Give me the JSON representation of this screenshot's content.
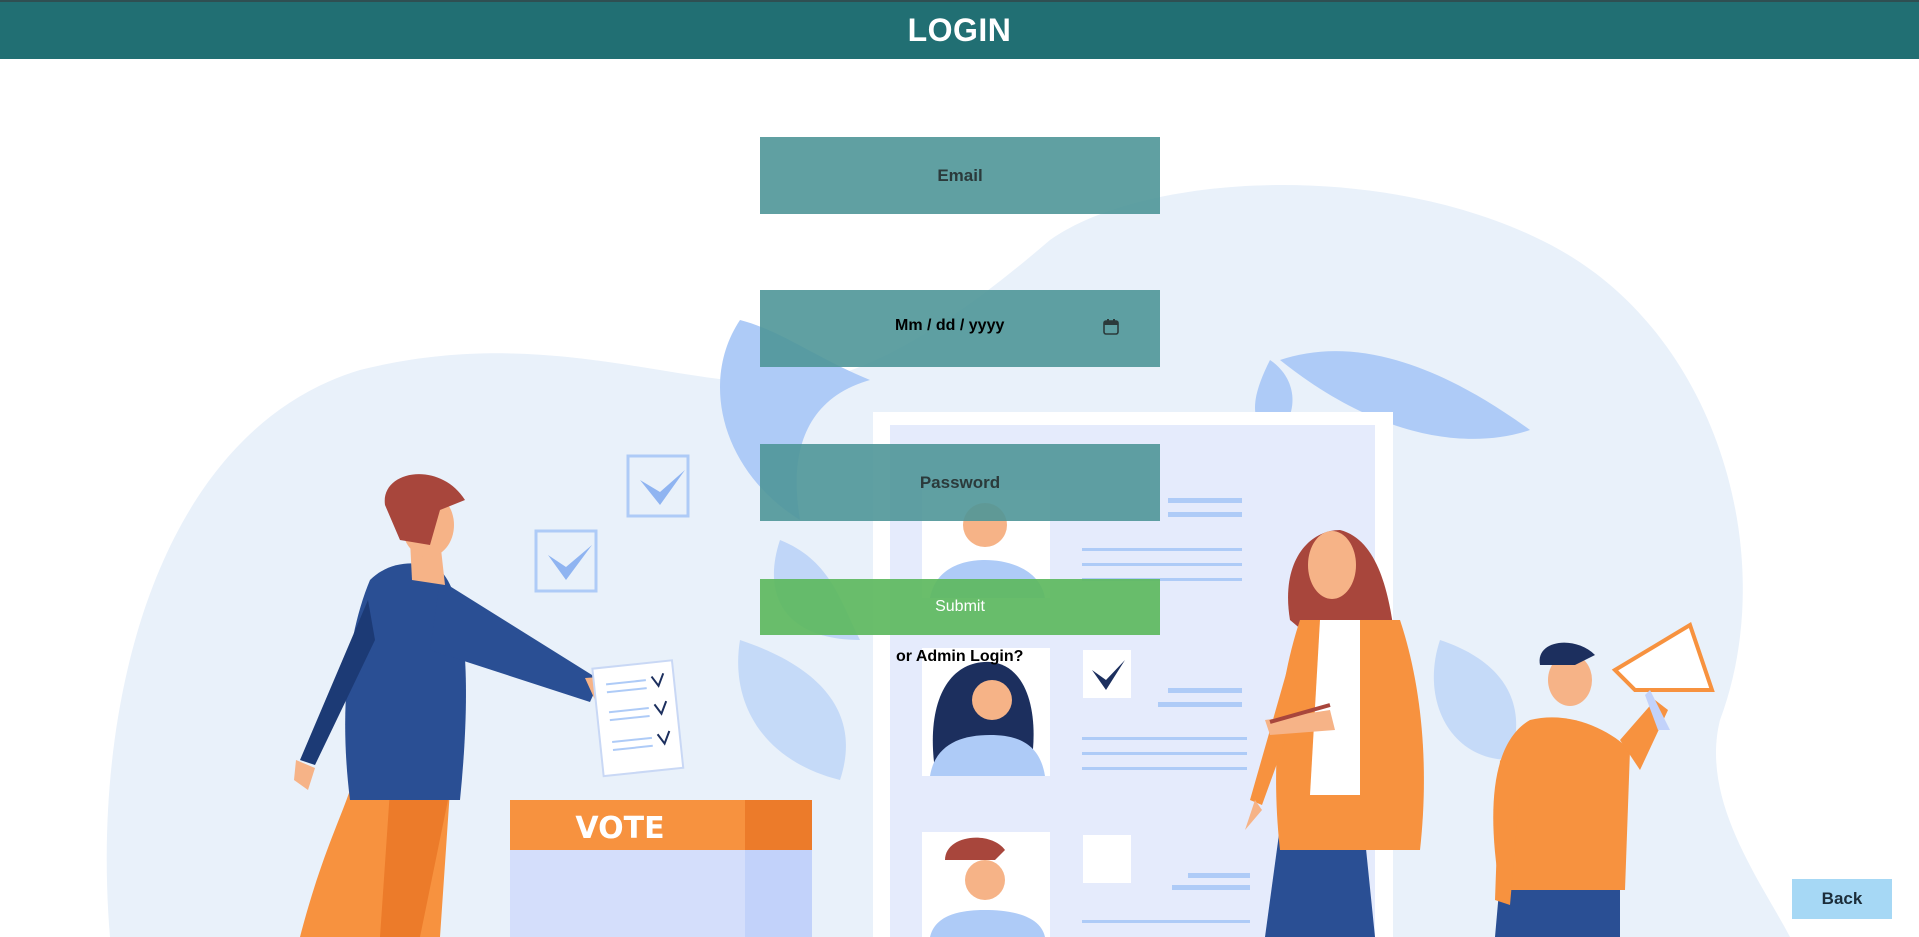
{
  "header": {
    "title": "LOGIN"
  },
  "form": {
    "email_placeholder": "Email",
    "date_placeholder": "Mm / dd / yyyy",
    "password_placeholder": "Password",
    "submit_label": "Submit",
    "admin_link": "or Admin Login?"
  },
  "back_label": "Back",
  "illustration": {
    "ballot_box_label": "VOTE"
  },
  "colors": {
    "header": "#216f73",
    "field": "#4f9698",
    "submit": "#5db85e",
    "back": "#a6d8f5",
    "accent_orange": "#f7923f",
    "accent_blue": "#2a4f94"
  }
}
